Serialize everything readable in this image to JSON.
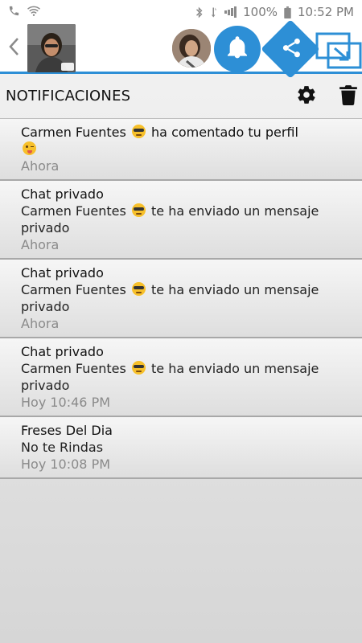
{
  "status_bar": {
    "battery": "100%",
    "time": "10:52 PM",
    "icons": [
      "phone-icon",
      "wifi-icon",
      "bluetooth-icon",
      "data-icon",
      "signal-icon"
    ]
  },
  "toolbar": {
    "icons": [
      "back-arrow-icon",
      "bell-icon",
      "share-icon",
      "expand-icon"
    ],
    "accent": "#2d8fd6"
  },
  "header": {
    "title": "NOTIFICACIONES",
    "icons": [
      "gear-icon",
      "trash-icon"
    ]
  },
  "notifications": [
    {
      "title": "Carmen Fuentes",
      "title_emoji": "sunglasses",
      "title_suffix": "ha comentado tu perfil",
      "body_emoji": "wink-tongue",
      "time": "Ahora"
    },
    {
      "title": "Chat privado",
      "body_name": "Carmen Fuentes",
      "body_text": "te ha enviado un mensaje privado",
      "time": "Ahora"
    },
    {
      "title": "Chat privado",
      "body_name": "Carmen Fuentes",
      "body_text": "te ha enviado un mensaje privado",
      "time": "Ahora"
    },
    {
      "title": "Chat privado",
      "body_name": "Carmen Fuentes",
      "body_text": "te ha enviado un mensaje privado",
      "time": "Hoy 10:46 PM"
    },
    {
      "title": "Freses Del Dia",
      "body_text": "No te Rindas",
      "time": "Hoy 10:08 PM"
    }
  ]
}
